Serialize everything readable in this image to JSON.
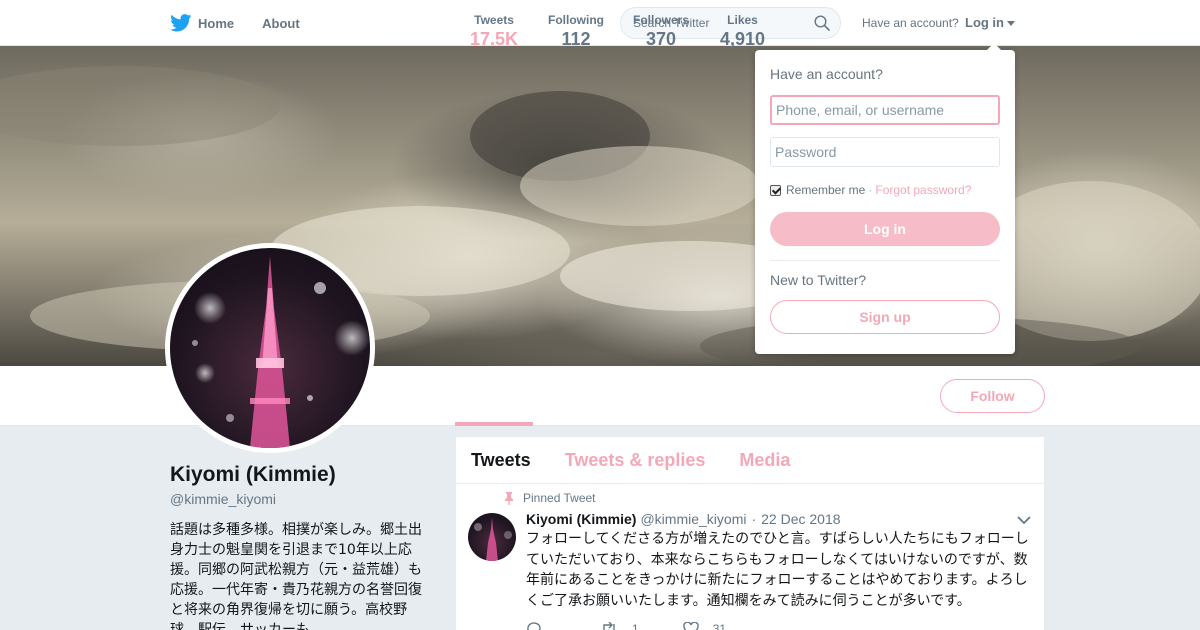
{
  "nav": {
    "home_label": "Home",
    "about_label": "About",
    "search_placeholder": "Search Twitter",
    "have_account": "Have an account?",
    "login_label": "Log in",
    "brand_color": "#1da1f2"
  },
  "login_dropdown": {
    "title": "Have an account?",
    "username_placeholder": "Phone, email, or username",
    "password_placeholder": "Password",
    "remember_label": "Remember me",
    "remember_checked": true,
    "separator": "·",
    "forgot_label": "Forgot password?",
    "login_button": "Log in",
    "new_label": "New to Twitter?",
    "signup_button": "Sign up"
  },
  "profile": {
    "name": "Kiyomi (Kimmie)",
    "handle": "@kimmie_kiyomi",
    "bio": "話題は多種多様。相撲が楽しみ。郷土出身力士の魁皇関を引退まで10年以上応援。同郷の阿武松親方（元・益荒雄）も応援。一代年寄・貴乃花親方の名誉回復と将来の角界復帰を切に願う。高校野球、駅伝、サッカーも",
    "accent_color": "#f4a8b7",
    "follow_button": "Follow",
    "stats": [
      {
        "label": "Tweets",
        "value": "17.5K"
      },
      {
        "label": "Following",
        "value": "112"
      },
      {
        "label": "Followers",
        "value": "370"
      },
      {
        "label": "Likes",
        "value": "4,910"
      }
    ]
  },
  "timeline": {
    "tabs": [
      "Tweets",
      "Tweets & replies",
      "Media"
    ],
    "pinned_label": "Pinned Tweet",
    "tweet": {
      "name": "Kiyomi (Kimmie)",
      "handle": "@kimmie_kiyomi",
      "dot": "·",
      "date": "22 Dec 2018",
      "text": "フォローしてくださる方が増えたのでひと言。すばらしい人たちにもフォローしていただいており、本来ならこちらもフォローしなくてはいけないのですが、数年前にあることをきっかけに新たにフォローすることはやめております。よろしくご了承お願いいたします。通知欄をみて読みに伺うことが多いです。",
      "retweets": "1",
      "likes": "31"
    }
  }
}
